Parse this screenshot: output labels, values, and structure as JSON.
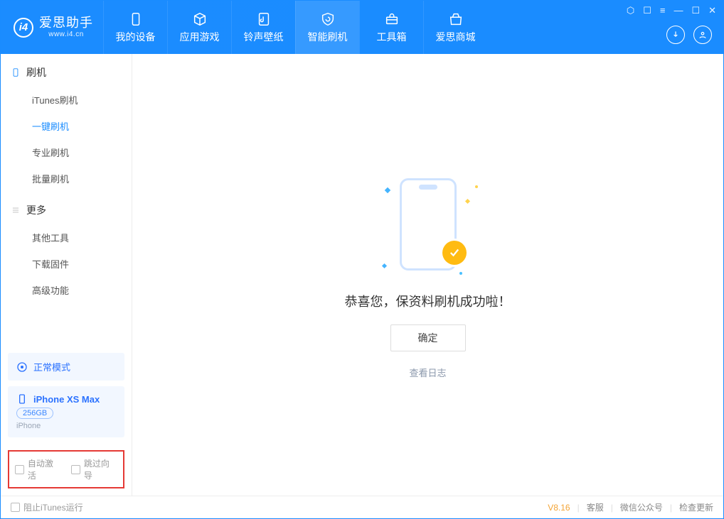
{
  "app": {
    "name": "爱思助手",
    "url": "www.i4.cn"
  },
  "tabs": [
    {
      "label": "我的设备"
    },
    {
      "label": "应用游戏"
    },
    {
      "label": "铃声壁纸"
    },
    {
      "label": "智能刷机",
      "active": true
    },
    {
      "label": "工具箱"
    },
    {
      "label": "爱思商城"
    }
  ],
  "sidebar": {
    "group1": {
      "title": "刷机"
    },
    "items1": [
      {
        "label": "iTunes刷机"
      },
      {
        "label": "一键刷机",
        "active": true
      },
      {
        "label": "专业刷机"
      },
      {
        "label": "批量刷机"
      }
    ],
    "group2": {
      "title": "更多"
    },
    "items2": [
      {
        "label": "其他工具"
      },
      {
        "label": "下载固件"
      },
      {
        "label": "高级功能"
      }
    ],
    "mode": "正常模式",
    "device": {
      "name": "iPhone XS Max",
      "storage": "256GB",
      "type": "iPhone"
    },
    "options": {
      "autoActivate": "自动激活",
      "skipGuide": "跳过向导"
    }
  },
  "main": {
    "message": "恭喜您，保资料刷机成功啦！",
    "ok": "确定",
    "viewLog": "查看日志"
  },
  "footer": {
    "blockItunes": "阻止iTunes运行",
    "version": "V8.16",
    "links": [
      "客服",
      "微信公众号",
      "检查更新"
    ]
  }
}
